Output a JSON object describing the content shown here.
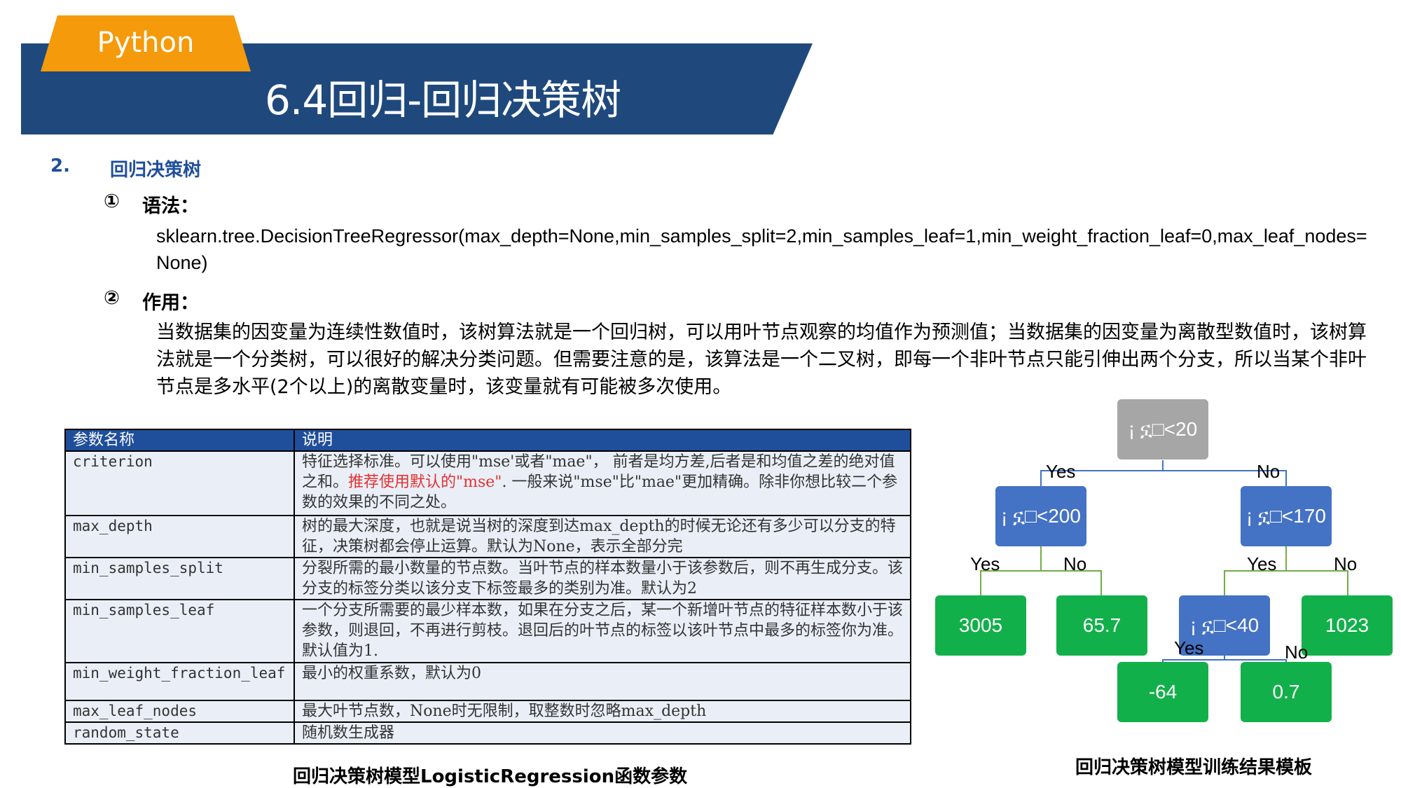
{
  "header": {
    "tab_label": "Python",
    "title": "6.4回归-回归决策树"
  },
  "section": {
    "number": "2.",
    "title": "回归决策树"
  },
  "syntax": {
    "mark": "①",
    "title": "语法：",
    "code": "sklearn.tree.DecisionTreeRegressor(max_depth=None,min_samples_split=2,min_samples_leaf=1,min_weight_fraction_leaf=0,max_leaf_nodes=None)"
  },
  "usage": {
    "mark": "②",
    "title": "作用：",
    "text": "当数据集的因变量为连续性数值时，该树算法就是一个回归树，可以用叶节点观察的均值作为预测值；当数据集的因变量为离散型数值时，该树算法就是一个分类树，可以很好的解决分类问题。但需要注意的是，该算法是一个二叉树，即每一个非叶节点只能引伸出两个分支，所以当某个非叶节点是多水平(2个以上)的离散变量时，该变量就有可能被多次使用。"
  },
  "table": {
    "headers": [
      "参数名称",
      "说明"
    ],
    "rows": [
      {
        "name": "criterion",
        "desc_a": "特征选择标准。可以使用\"mse'或者\"mae\"， 前者是均方差,后者是和均值之差的绝对值之和。",
        "desc_red": "推荐使用默认的\"mse\"",
        "desc_b": ". 一般来说\"mse\"比\"mae\"更加精确。除非你想比较二个参数的效果的不同之处。"
      },
      {
        "name": "max_depth",
        "desc_a": "树的最大深度，也就是说当树的深度到达max_depth的时候无论还有多少可以分支的特征，决策树都会停止运算。默认为None，表示全部分完",
        "desc_red": "",
        "desc_b": ""
      },
      {
        "name": "min_samples_split",
        "desc_a": "分裂所需的最小数量的节点数。当叶节点的样本数量小于该参数后，则不再生成分支。该分支的标签分类以该分支下标签最多的类别为准。默认为2",
        "desc_red": "",
        "desc_b": ""
      },
      {
        "name": "min_samples_leaf",
        "desc_a": "一个分支所需要的最少样本数，如果在分支之后，某一个新增叶节点的特征样本数小于该参数，则退回，不再进行剪枝。退回后的叶节点的标签以该叶节点中最多的标签你为准。默认值为1.",
        "desc_red": "",
        "desc_b": ""
      },
      {
        "name": "min_weight_fraction_leaf",
        "desc_a": "最小的权重系数，默认为0",
        "desc_red": "",
        "desc_b": ""
      },
      {
        "name": "max_leaf_nodes",
        "desc_a": "最大叶节点数，None时无限制，取整数时忽略max_depth",
        "desc_red": "",
        "desc_b": ""
      },
      {
        "name": "random_state",
        "desc_a": "随机数生成器",
        "desc_red": "",
        "desc_b": ""
      }
    ],
    "caption": "回归决策树模型LogisticRegression函数参数"
  },
  "tree": {
    "caption": "回归决策树模型训练结果模板",
    "colors": {
      "root": "#A6A6A6",
      "split": "#4472C4",
      "leaf": "#12B04A"
    },
    "nodes": {
      "root": "¡ ኗ□<20",
      "left": "¡ ኗ□<200",
      "right": "¡ ኗ□<170",
      "leaf_3005": "3005",
      "leaf_65_7": "65.7",
      "mid": "¡ ኗ□<40",
      "leaf_1023": "1023",
      "leaf_neg64": "-64",
      "leaf_0_7": "0.7"
    },
    "labels": {
      "yes": "Yes",
      "no": "No"
    }
  }
}
